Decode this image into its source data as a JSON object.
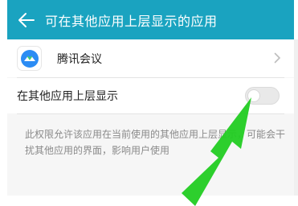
{
  "header": {
    "title": "可在其他应用上层显示的应用",
    "back_icon": "arrow-left-icon",
    "background": "#1aa3c0"
  },
  "app_row": {
    "name": "腾讯会议",
    "icon": "tencent-meeting-icon",
    "chevron_icon": "chevron-right-icon"
  },
  "overlay_setting": {
    "label": "在其他应用上层显示",
    "enabled": false
  },
  "description": "此权限允许该应用在当前使用的其他应用上层显示，可能会干扰其他应用的界面，影响用户使用",
  "annotation": {
    "type": "arrow",
    "color": "#22cc22"
  }
}
